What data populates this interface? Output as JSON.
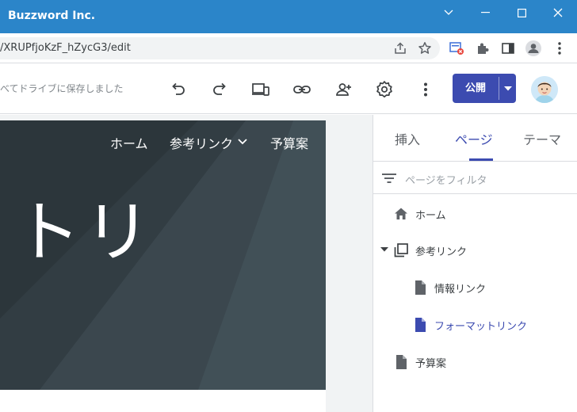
{
  "window": {
    "title": "Buzzword Inc.",
    "controls": [
      "chevron-down",
      "minimize",
      "maximize",
      "close"
    ]
  },
  "address_bar": {
    "url": "/XRUPfjoKzF_hZycG3/edit",
    "icons": [
      "share-icon",
      "bookmark-star-icon",
      "extension-alert-icon",
      "puzzle-icon",
      "side-panel-icon",
      "profile-icon",
      "more-vert-icon"
    ]
  },
  "toolbar": {
    "save_status": "べてドライブに保存しました",
    "icons": [
      "undo-icon",
      "redo-icon",
      "preview-devices-icon",
      "link-icon",
      "add-person-icon",
      "settings-icon",
      "more-vert-icon"
    ],
    "publish_label": "公開"
  },
  "site": {
    "nav": {
      "home": "ホーム",
      "reference_links": "参考リンク",
      "budget": "予算案"
    },
    "hero_title": "トリ"
  },
  "panel": {
    "tabs": {
      "insert": "挿入",
      "pages": "ページ",
      "themes": "テーマ"
    },
    "active_tab": "ページ",
    "filter_placeholder": "ページをフィルタ",
    "pages": {
      "home": "ホーム",
      "reference_links": "参考リンク",
      "info_links": "情報リンク",
      "format_links": "フォーマットリンク",
      "budget": "予算案"
    },
    "selected_page": "フォーマットリンク"
  },
  "colors": {
    "titlebar": "#2b85c9",
    "accent": "#3c4bb0",
    "hero": "#2f3a40"
  }
}
